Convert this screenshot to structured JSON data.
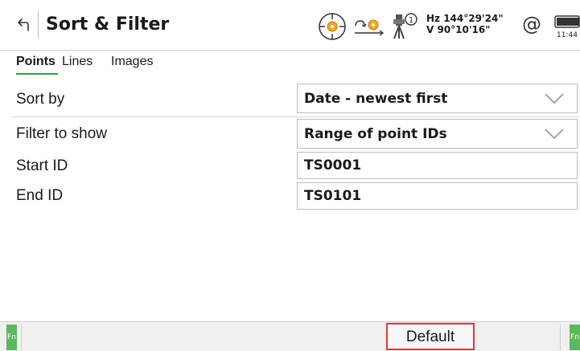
{
  "header": {
    "title": "Sort & Filter",
    "angles": {
      "hz": "Hz 144°29'24\"",
      "v": "V  90°10'16\""
    },
    "at_symbol": "@",
    "clock": "11:44",
    "instrument_number": "1"
  },
  "tabs": [
    {
      "label": "Points",
      "active": true
    },
    {
      "label": "Lines",
      "active": false
    },
    {
      "label": "Images",
      "active": false
    }
  ],
  "form": {
    "sort_by": {
      "label": "Sort by",
      "value": "Date - newest first"
    },
    "filter": {
      "label": "Filter to show",
      "value": "Range of point IDs"
    },
    "start_id": {
      "label": "Start ID",
      "value": "TS0001"
    },
    "end_id": {
      "label": "End ID",
      "value": "TS0101"
    }
  },
  "footer": {
    "fn_left": "Fn",
    "fn_right": "Fn",
    "default_label": "Default"
  },
  "colors": {
    "accent_green": "#2e9e3e",
    "fn_green": "#5cb85c",
    "highlight_red": "#d93a3a",
    "target_orange": "#f5a623"
  },
  "icons": [
    "back-icon",
    "target-icon",
    "prism-icon",
    "instrument-icon",
    "battery-icon",
    "chevron-down-icon"
  ]
}
